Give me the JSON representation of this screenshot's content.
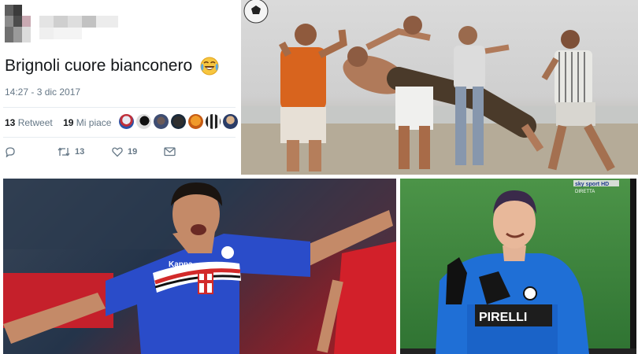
{
  "tweet": {
    "text": "Brignoli cuore bianconero",
    "emoji_icon": "face-with-tears-of-joy-icon",
    "timestamp": "14:27 - 3 dic 2017",
    "retweet_count": "13",
    "retweet_label": "Retweet",
    "likes_count": "19",
    "likes_label": "Mi piace",
    "actions": {
      "reply_icon": "reply-icon",
      "retweet_count": "13",
      "like_count": "19",
      "dm_icon": "envelope-icon"
    },
    "colors": {
      "text": "#14171a",
      "muted": "#657786"
    }
  },
  "tv_overlay": {
    "channel": "sky sport HD",
    "badge": "DIRETTA"
  },
  "jerseys": {
    "kit_brand": "Kappa",
    "sponsor": "PIRELLI"
  }
}
